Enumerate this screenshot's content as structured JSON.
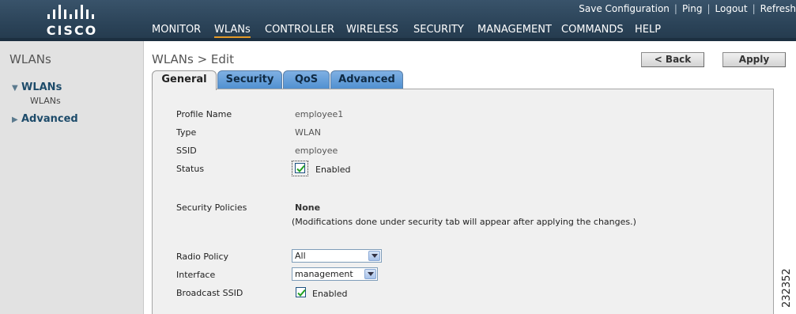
{
  "brand": {
    "logo_text": "CISCO"
  },
  "top_links": [
    "Save Configuration",
    "Ping",
    "Logout",
    "Refresh"
  ],
  "menu": [
    "MONITOR",
    "WLANs",
    "CONTROLLER",
    "WIRELESS",
    "SECURITY",
    "MANAGEMENT",
    "COMMANDS",
    "HELP"
  ],
  "sidebar": {
    "title": "WLANs",
    "nodes": [
      {
        "label": "WLANs",
        "expanded": true,
        "children": [
          "WLANs"
        ]
      },
      {
        "label": "Advanced",
        "expanded": false
      }
    ]
  },
  "page": {
    "title": "WLANs > Edit",
    "back_label": "< Back",
    "apply_label": "Apply"
  },
  "tabs": [
    {
      "label": "General",
      "active": true
    },
    {
      "label": "Security",
      "active": false
    },
    {
      "label": "QoS",
      "active": false
    },
    {
      "label": "Advanced",
      "active": false
    }
  ],
  "form": {
    "profile_name_label": "Profile Name",
    "profile_name": "employee1",
    "type_label": "Type",
    "type": "WLAN",
    "ssid_label": "SSID",
    "ssid": "employee",
    "status_label": "Status",
    "status_checked": true,
    "status_text": "Enabled",
    "security_policies_label": "Security Policies",
    "security_policies": "None",
    "security_note": "(Modifications done under security tab will appear after applying the changes.)",
    "radio_policy_label": "Radio Policy",
    "radio_policy": "All",
    "interface_label": "Interface",
    "interface": "management",
    "broadcast_ssid_label": "Broadcast SSID",
    "broadcast_checked": true,
    "broadcast_text": "Enabled"
  },
  "doc_number": "232352",
  "colors": {
    "header": "#2b4358",
    "accent_underline": "#e49a28",
    "tab_blue": "#4f8fd0",
    "link_blue": "#1d4b6a"
  }
}
